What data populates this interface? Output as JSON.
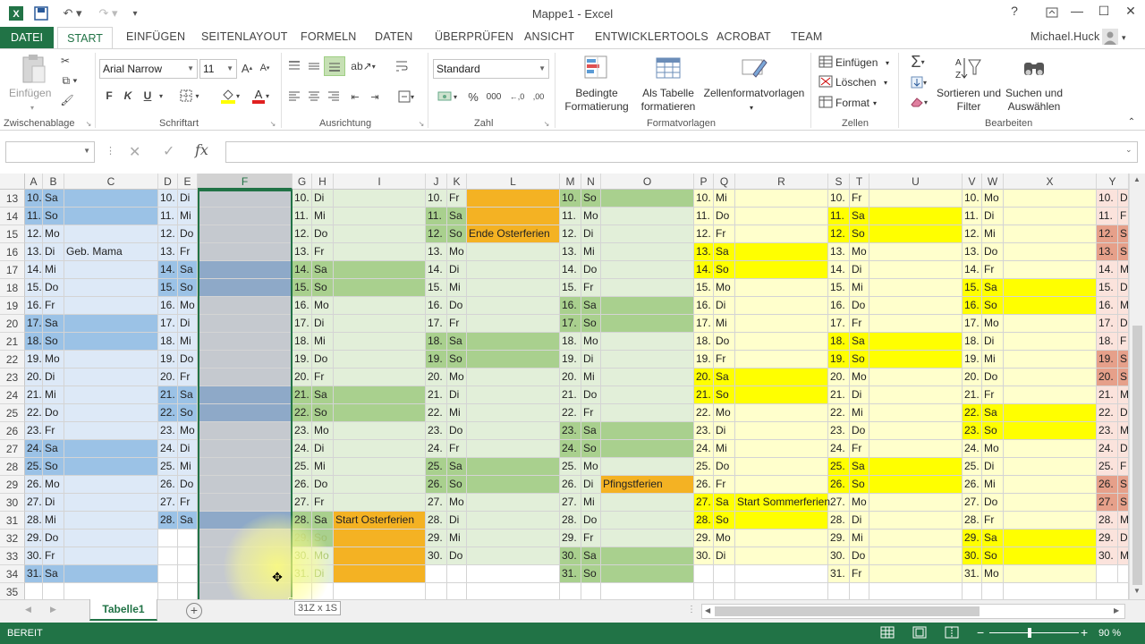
{
  "window": {
    "title": "Mappe1 - Excel",
    "user": "Michael.Huck"
  },
  "tabs": [
    "DATEI",
    "START",
    "EINFÜGEN",
    "SEITENLAYOUT",
    "FORMELN",
    "DATEN",
    "ÜBERPRÜFEN",
    "ANSICHT",
    "ENTWICKLERTOOLS",
    "ACROBAT",
    "TEAM"
  ],
  "ribbon": {
    "clipboard": {
      "paste": "Einfügen",
      "label": "Zwischenablage"
    },
    "font": {
      "name": "Arial Narrow",
      "size": "11",
      "bold": "F",
      "italic": "K",
      "underline": "U",
      "label": "Schriftart"
    },
    "alignment": {
      "label": "Ausrichtung"
    },
    "number": {
      "format": "Standard",
      "label": "Zahl"
    },
    "styles": {
      "cond": "Bedingte\nFormatierung",
      "table": "Als Tabelle\nformatieren",
      "cellstyles": "Zellenformatvorlagen",
      "label": "Formatvorlagen"
    },
    "cells": {
      "insert": "Einfügen",
      "delete": "Löschen",
      "format": "Format",
      "label": "Zellen"
    },
    "edit": {
      "sort": "Sortieren und\nFilter",
      "find": "Suchen und\nAuswählen",
      "label": "Bearbeiten"
    }
  },
  "formula_bar": {
    "fx": "fx",
    "value": ""
  },
  "columns": [
    "A",
    "B",
    "C",
    "D",
    "E",
    "F",
    "G",
    "H",
    "I",
    "J",
    "K",
    "L",
    "M",
    "N",
    "O",
    "P",
    "Q",
    "R",
    "S",
    "T",
    "U",
    "V",
    "W",
    "X",
    "Y"
  ],
  "rows": [
    "13",
    "14",
    "15",
    "16",
    "17",
    "18",
    "19",
    "20",
    "21",
    "22",
    "23",
    "24",
    "25",
    "26",
    "27",
    "28",
    "29",
    "30",
    "31",
    "32",
    "33",
    "34",
    "35"
  ],
  "months": [
    {
      "days": [
        "10.",
        "11.",
        "12.",
        "13.",
        "14.",
        "15.",
        "16.",
        "17.",
        "18.",
        "19.",
        "20.",
        "21.",
        "22.",
        "23.",
        "24.",
        "25.",
        "26.",
        "27.",
        "28.",
        "29.",
        "30.",
        "31."
      ],
      "wd": [
        "Sa",
        "So",
        "Mo",
        "Di",
        "Mi",
        "Do",
        "Fr",
        "Sa",
        "So",
        "Mo",
        "Di",
        "Mi",
        "Do",
        "Fr",
        "Sa",
        "So",
        "Mo",
        "Di",
        "Mi",
        "Do",
        "Fr",
        "Sa"
      ],
      "notes": {
        "3": "Geb. Mama"
      }
    },
    {
      "days": [
        "10.",
        "11.",
        "12.",
        "13.",
        "14.",
        "15.",
        "16.",
        "17.",
        "18.",
        "19.",
        "20.",
        "21.",
        "22.",
        "23.",
        "24.",
        "25.",
        "26.",
        "27.",
        "28."
      ],
      "wd": [
        "Di",
        "Mi",
        "Do",
        "Fr",
        "Sa",
        "So",
        "Mo",
        "Di",
        "Mi",
        "Do",
        "Fr",
        "Sa",
        "So",
        "Mo",
        "Di",
        "Mi",
        "Do",
        "Fr",
        "Sa"
      ],
      "notes": {}
    },
    {
      "days": [
        "10.",
        "11.",
        "12.",
        "13.",
        "14.",
        "15.",
        "16.",
        "17.",
        "18.",
        "19.",
        "20.",
        "21.",
        "22.",
        "23.",
        "24.",
        "25.",
        "26.",
        "27.",
        "28.",
        "29.",
        "30.",
        "31."
      ],
      "wd": [
        "Di",
        "Mi",
        "Do",
        "Fr",
        "Sa",
        "So",
        "Mo",
        "Di",
        "Mi",
        "Do",
        "Fr",
        "Sa",
        "So",
        "Mo",
        "Di",
        "Mi",
        "Do",
        "Fr",
        "Sa",
        "So",
        "Mo",
        "Di"
      ],
      "notes": {
        "18": "Start Osterferien"
      }
    },
    {
      "days": [
        "10.",
        "11.",
        "12.",
        "13.",
        "14.",
        "15.",
        "16.",
        "17.",
        "18.",
        "19.",
        "20.",
        "21.",
        "22.",
        "23.",
        "24.",
        "25.",
        "26.",
        "27.",
        "28.",
        "29.",
        "30."
      ],
      "wd": [
        "Fr",
        "Sa",
        "So",
        "Mo",
        "Di",
        "Mi",
        "Do",
        "Fr",
        "Sa",
        "So",
        "Mo",
        "Di",
        "Mi",
        "Do",
        "Fr",
        "Sa",
        "So",
        "Mo",
        "Di",
        "Mi",
        "Do"
      ],
      "notes": {
        "2": "Ende Osterferien"
      }
    },
    {
      "days": [
        "10.",
        "11.",
        "12.",
        "13.",
        "14.",
        "15.",
        "16.",
        "17.",
        "18.",
        "19.",
        "20.",
        "21.",
        "22.",
        "23.",
        "24.",
        "25.",
        "26.",
        "27.",
        "28.",
        "29.",
        "30.",
        "31."
      ],
      "wd": [
        "So",
        "Mo",
        "Di",
        "Mi",
        "Do",
        "Fr",
        "Sa",
        "So",
        "Mo",
        "Di",
        "Mi",
        "Do",
        "Fr",
        "Sa",
        "So",
        "Mo",
        "Di",
        "Mi",
        "Do",
        "Fr",
        "Sa",
        "So"
      ],
      "notes": {
        "16": "Pfingstferien"
      }
    },
    {
      "days": [
        "10.",
        "11.",
        "12.",
        "13.",
        "14.",
        "15.",
        "16.",
        "17.",
        "18.",
        "19.",
        "20.",
        "21.",
        "22.",
        "23.",
        "24.",
        "25.",
        "26.",
        "27.",
        "28.",
        "29.",
        "30."
      ],
      "wd": [
        "Mi",
        "Do",
        "Fr",
        "Sa",
        "So",
        "Mo",
        "Di",
        "Mi",
        "Do",
        "Fr",
        "Sa",
        "So",
        "Mo",
        "Di",
        "Mi",
        "Do",
        "Fr",
        "Sa",
        "So",
        "Mo",
        "Di"
      ],
      "notes": {
        "17": "Start Sommerferien"
      }
    },
    {
      "days": [
        "10.",
        "11.",
        "12.",
        "13.",
        "14.",
        "15.",
        "16.",
        "17.",
        "18.",
        "19.",
        "20.",
        "21.",
        "22.",
        "23.",
        "24.",
        "25.",
        "26.",
        "27.",
        "28.",
        "29.",
        "30.",
        "31."
      ],
      "wd": [
        "Fr",
        "Sa",
        "So",
        "Mo",
        "Di",
        "Mi",
        "Do",
        "Fr",
        "Sa",
        "So",
        "Mo",
        "Di",
        "Mi",
        "Do",
        "Fr",
        "Sa",
        "So",
        "Mo",
        "Di",
        "Mi",
        "Do",
        "Fr"
      ],
      "notes": {}
    },
    {
      "days": [
        "10.",
        "11.",
        "12.",
        "13.",
        "14.",
        "15.",
        "16.",
        "17.",
        "18.",
        "19.",
        "20.",
        "21.",
        "22.",
        "23.",
        "24.",
        "25.",
        "26.",
        "27.",
        "28.",
        "29.",
        "30.",
        "31."
      ],
      "wd": [
        "Mo",
        "Di",
        "Mi",
        "Do",
        "Fr",
        "Sa",
        "So",
        "Mo",
        "Di",
        "Mi",
        "Do",
        "Fr",
        "Sa",
        "So",
        "Mo",
        "Di",
        "Mi",
        "Do",
        "Fr",
        "Sa",
        "So",
        "Mo"
      ],
      "notes": {}
    }
  ],
  "y_partial": {
    "days": [
      "10.",
      "11.",
      "12.",
      "13.",
      "14.",
      "15.",
      "16.",
      "17.",
      "18.",
      "19.",
      "20.",
      "21.",
      "22.",
      "23.",
      "24.",
      "25.",
      "26.",
      "27.",
      "28.",
      "29.",
      "30."
    ],
    "wd": [
      "D",
      "F",
      "S",
      "S",
      "M",
      "D",
      "M",
      "D",
      "F",
      "S",
      "S",
      "M",
      "D",
      "M",
      "D",
      "F",
      "S",
      "S",
      "M",
      "D",
      "M"
    ]
  },
  "selection_tip": "31Z x 1S",
  "sheet": {
    "tab": "Tabelle1"
  },
  "status": {
    "ready": "BEREIT",
    "zoom": "90 %"
  },
  "colors": {
    "accent": "#217346",
    "blue_we": "#9bc2e6",
    "blue_wd": "#dde9f7",
    "blue_dark": "#8ea9c8",
    "green_we": "#a9d08e",
    "green_wd": "#e2efd9",
    "yellow_we": "#ffff00",
    "yellow_wd": "#ffffcc",
    "orange": "#f4b223",
    "sel": "#c5c9cf"
  }
}
